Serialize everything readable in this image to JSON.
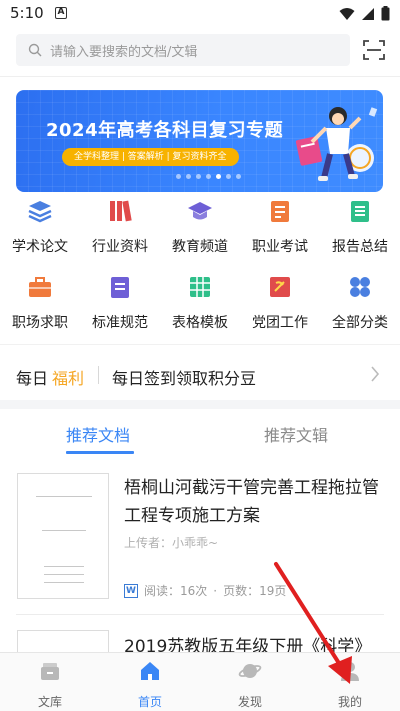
{
  "status_bar": {
    "time": "5:10",
    "notification_glyph": "A"
  },
  "search": {
    "placeholder": "请输入要搜索的文档/文辑"
  },
  "banner": {
    "title": "2024年高考各科目复习专题",
    "subtitle": "全学科整理 | 答案解析 | 复习资料齐全",
    "slide_count": 7,
    "active_slide": 4
  },
  "categories": [
    {
      "label": "学术论文",
      "icon": "stack-layers-icon",
      "color": "#4a7fe0"
    },
    {
      "label": "行业资料",
      "icon": "books-icon",
      "color": "#e04b4b"
    },
    {
      "label": "教育频道",
      "icon": "graduation-cap-icon",
      "color": "#6e5fd6"
    },
    {
      "label": "职业考试",
      "icon": "exam-doc-icon",
      "color": "#f07a3c"
    },
    {
      "label": "报告总结",
      "icon": "report-icon",
      "color": "#2fbf8a"
    },
    {
      "label": "职场求职",
      "icon": "briefcase-icon",
      "color": "#f07a3c"
    },
    {
      "label": "标准规范",
      "icon": "standard-doc-icon",
      "color": "#6e5fd6"
    },
    {
      "label": "表格模板",
      "icon": "table-grid-icon",
      "color": "#2fbf8a"
    },
    {
      "label": "党团工作",
      "icon": "party-emblem-icon",
      "color": "#e04b4b"
    },
    {
      "label": "全部分类",
      "icon": "all-categories-icon",
      "color": "#4a7fe0"
    }
  ],
  "daily": {
    "prefix": "每日",
    "highlight": "福利",
    "text": "每日签到领取积分豆"
  },
  "tabs": [
    {
      "label": "推荐文档",
      "active": true
    },
    {
      "label": "推荐文辑",
      "active": false
    }
  ],
  "documents": [
    {
      "title": "梧桐山河截污干管完善工程拖拉管工程专项施工方案",
      "uploader": "上传者：小乖乖~",
      "reads": "阅读：16次",
      "pages": "页数：19页",
      "type_badge": "W"
    },
    {
      "title": "2019苏教版五年级下册《科学》"
    }
  ],
  "bottom_nav": [
    {
      "label": "文库",
      "icon": "library-box-icon",
      "active": false
    },
    {
      "label": "首页",
      "icon": "home-icon",
      "active": true
    },
    {
      "label": "发现",
      "icon": "planet-icon",
      "active": false
    },
    {
      "label": "我的",
      "icon": "user-profile-icon",
      "active": false
    }
  ],
  "colors": {
    "accent": "#3a86f5",
    "highlight": "#f5a623",
    "annotation": "#e02020"
  }
}
